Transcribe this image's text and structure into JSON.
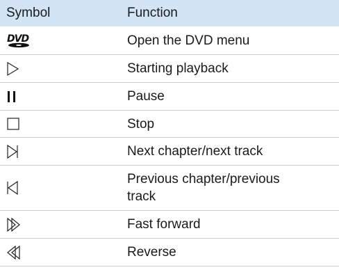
{
  "table": {
    "headers": {
      "symbol": "Symbol",
      "function": "Function"
    },
    "rows": [
      {
        "icon": "dvd-logo-icon",
        "function": "Open the DVD menu"
      },
      {
        "icon": "play-icon",
        "function": "Starting playback"
      },
      {
        "icon": "pause-icon",
        "function": "Pause"
      },
      {
        "icon": "stop-icon",
        "function": "Stop"
      },
      {
        "icon": "next-track-icon",
        "function": "Next chapter/next track"
      },
      {
        "icon": "previous-track-icon",
        "function_line1": "Previous chapter/previous",
        "function_line2": "track"
      },
      {
        "icon": "fast-forward-icon",
        "function": "Fast forward"
      },
      {
        "icon": "reverse-icon",
        "function": "Reverse"
      }
    ]
  },
  "colors": {
    "header_bg": "#d3e4f5",
    "row_border": "#cfcfcf",
    "text": "#1a1a1a"
  }
}
